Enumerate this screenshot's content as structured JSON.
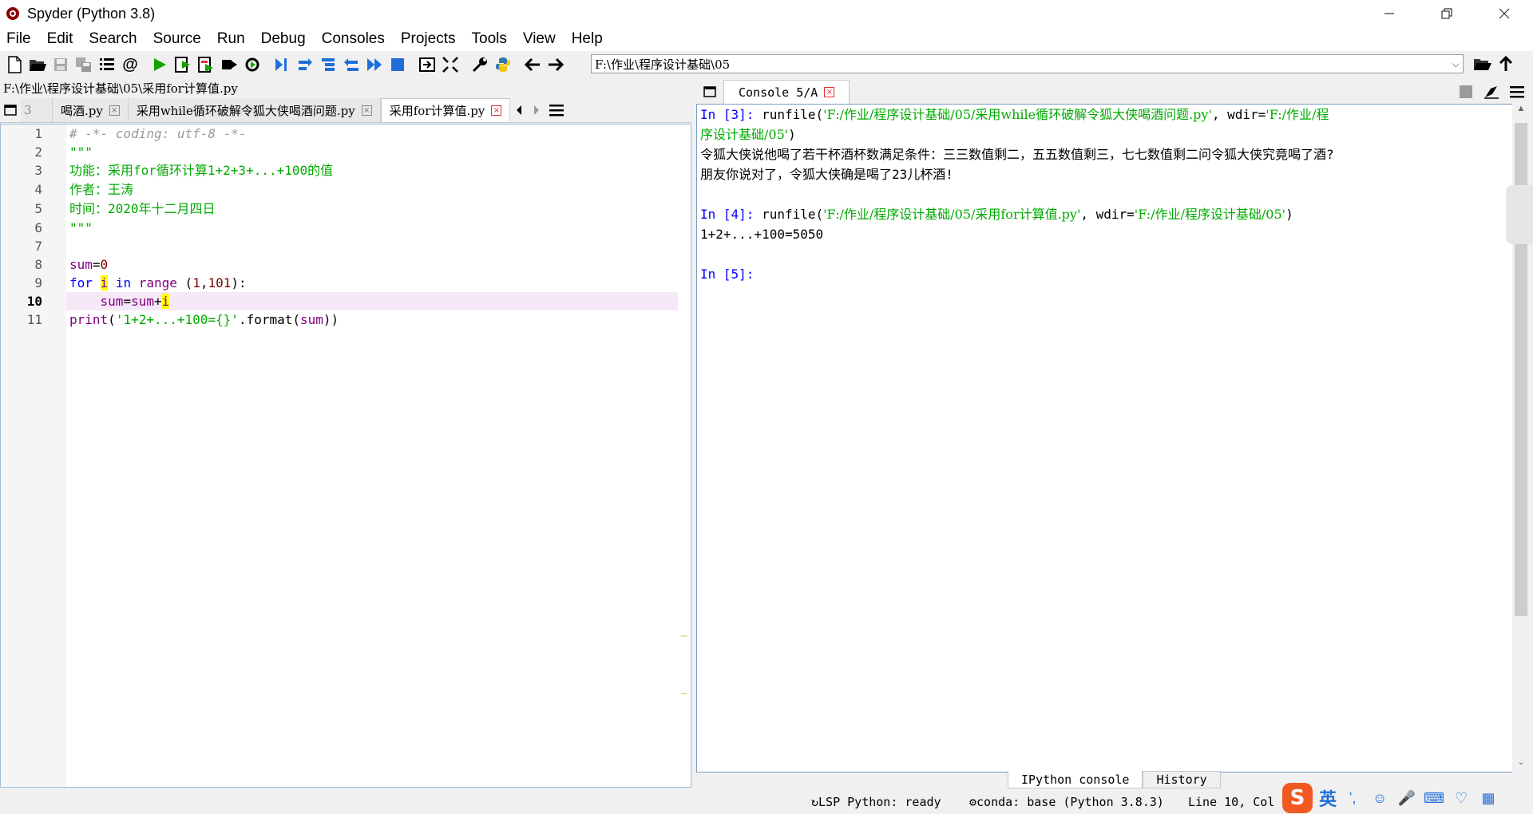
{
  "window": {
    "title": "Spyder (Python 3.8)"
  },
  "menu": [
    "File",
    "Edit",
    "Search",
    "Source",
    "Run",
    "Debug",
    "Consoles",
    "Projects",
    "Tools",
    "View",
    "Help"
  ],
  "toolbar": {
    "working_dir": "F:\\作业\\程序设计基础\\05"
  },
  "editor": {
    "file_path": "F:\\作业\\程序设计基础\\05\\采用for计算值.py",
    "tabs": [
      {
        "label": "3"
      },
      {
        "label": "喝酒.py"
      },
      {
        "label": "采用while循环破解令狐大侠喝酒问题.py"
      },
      {
        "label": "采用for计算值.py"
      }
    ],
    "line_numbers": [
      "1",
      "2",
      "3",
      "4",
      "5",
      "6",
      "7",
      "8",
      "9",
      "10",
      "11"
    ],
    "current_line": 10
  },
  "console": {
    "tab_label": "Console 5/A",
    "lines": {
      "l1_prompt": "In [3]:",
      "l1_call": " runfile(",
      "l1_arg1": "'F:/作业/程序设计基础/05/采用while循环破解令狐大侠喝酒问题.py'",
      "l1_mid": ", wdir=",
      "l1_arg2": "'F:/作业/程",
      "l2_arg2": "序设计基础/05'",
      "l2_end": ")",
      "l3": "令狐大侠说他喝了若干杯酒杯数满足条件：三三数值剩二，五五数值剩三，七七数值剩二问令狐大侠究竟喝了酒?",
      "l4": "朋友你说对了，令狐大侠确是喝了23儿杯酒!",
      "l6_prompt": "In [4]:",
      "l6_call": " runfile(",
      "l6_arg1": "'F:/作业/程序设计基础/05/采用for计算值.py'",
      "l6_mid": ", wdir=",
      "l6_arg2": "'F:/作业/程序设计基础/05'",
      "l6_end": ")",
      "l7": "1+2+...+100=5050",
      "l9_prompt": "In [5]:"
    },
    "bottom_tabs": [
      "IPython console",
      "History"
    ]
  },
  "status": {
    "lsp": "LSP Python: ready",
    "conda": "conda: base (Python 3.8.3)",
    "position": "Line 10, Col 1"
  },
  "ime": {
    "lang": "英"
  }
}
